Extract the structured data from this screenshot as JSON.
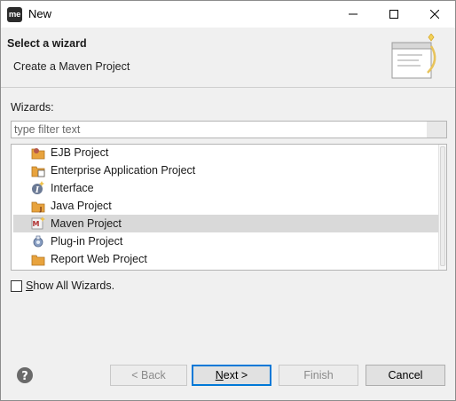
{
  "window": {
    "app_icon_text": "me",
    "title": "New"
  },
  "header": {
    "title": "Select a wizard",
    "description": "Create a Maven Project"
  },
  "wizards": {
    "label": "Wizards:",
    "filter_placeholder": "type filter text",
    "items": [
      {
        "label": "EJB Project",
        "icon": "ejb-project-icon",
        "selected": false
      },
      {
        "label": "Enterprise Application Project",
        "icon": "enterprise-application-icon",
        "selected": false
      },
      {
        "label": "Interface",
        "icon": "interface-icon",
        "selected": false
      },
      {
        "label": "Java Project",
        "icon": "java-project-icon",
        "selected": false
      },
      {
        "label": "Maven Project",
        "icon": "maven-project-icon",
        "selected": true
      },
      {
        "label": "Plug-in Project",
        "icon": "plugin-project-icon",
        "selected": false
      },
      {
        "label": "Report Web Project",
        "icon": "report-web-project-icon",
        "selected": false
      }
    ]
  },
  "options": {
    "show_all_prefix": "S",
    "show_all_rest": "how All Wizards.",
    "show_all_checked": false
  },
  "buttons": {
    "back": "< Back",
    "next_mnemonic": "N",
    "next_rest": "ext >",
    "finish": "Finish",
    "cancel": "Cancel"
  },
  "colors": {
    "selection": "#d9d9d9",
    "default_button_border": "#0078d7",
    "folder": "#e8a33d"
  }
}
